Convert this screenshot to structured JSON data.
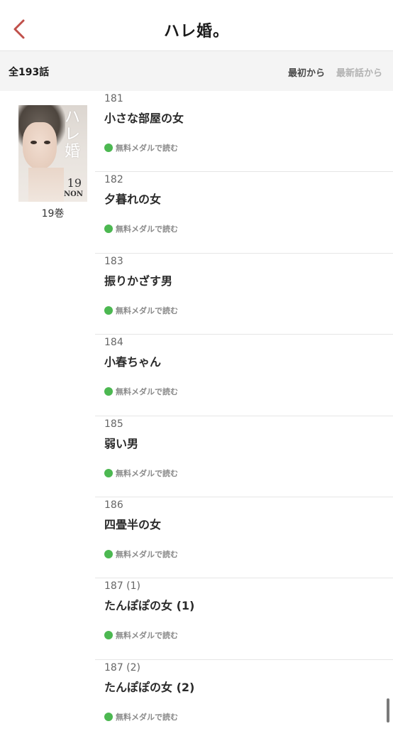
{
  "nav": {
    "title": "ハレ婚。",
    "back_icon": "chevron-left-icon",
    "accent": "#c0504a"
  },
  "sortbar": {
    "count": "全193話",
    "first_label": "最初から",
    "latest_label": "最新話から"
  },
  "volume": {
    "label": "19巻",
    "cover_title": "ハレ婚",
    "cover_number": "19",
    "cover_author": "NON"
  },
  "episodes": [
    {
      "num": "181",
      "title": "小さな部屋の女",
      "status": "無料メダルで読む"
    },
    {
      "num": "182",
      "title": "夕暮れの女",
      "status": "無料メダルで読む"
    },
    {
      "num": "183",
      "title": "振りかざす男",
      "status": "無料メダルで読む"
    },
    {
      "num": "184",
      "title": "小春ちゃん",
      "status": "無料メダルで読む"
    },
    {
      "num": "185",
      "title": "弱い男",
      "status": "無料メダルで読む"
    },
    {
      "num": "186",
      "title": "四畳半の女",
      "status": "無料メダルで読む"
    },
    {
      "num": "187 (1)",
      "title": "たんぽぽの女 (1)",
      "status": "無料メダルで読む"
    },
    {
      "num": "187 (2)",
      "title": "たんぽぽの女 (2)",
      "status": "無料メダルで読む"
    }
  ],
  "colors": {
    "status_dot": "#4cb851"
  }
}
